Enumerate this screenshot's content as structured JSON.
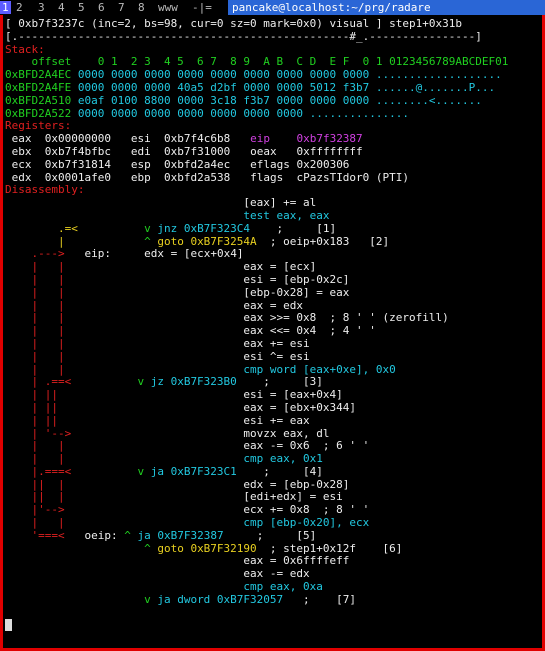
{
  "tabs": [
    {
      "label": "1",
      "active": true
    },
    {
      "label": "2",
      "active": false
    },
    {
      "label": "3",
      "active": false
    },
    {
      "label": "4",
      "active": false
    },
    {
      "label": "5",
      "active": false
    },
    {
      "label": "6",
      "active": false
    },
    {
      "label": "7",
      "active": false
    },
    {
      "label": "8",
      "active": false
    },
    {
      "label": "www",
      "active": false
    },
    {
      "label": "-|=",
      "active": false
    }
  ],
  "host_title": "pancake@localhost:~/prg/radare",
  "status_line": "[ 0xb7f3237c (inc=2, bs=98, cur=0 sz=0 mark=0x0) visual ] step1+0x31b",
  "ruler": "[.--------------------------------------------------#_.----------------]",
  "stack": {
    "label": "Stack:",
    "header": "    offset    0 1  2 3  4 5  6 7  8 9  A B  C D  E F  0 1 0123456789ABCDEF01",
    "rows": [
      {
        "addr": "0xBFD2A4EC",
        "hex": "0000 0000 0000 0000 0000 0000 0000 0000 0000",
        "ascii": "..................."
      },
      {
        "addr": "0xBFD2A4FE",
        "hex": "0000 0000 0000 40a5 d2bf 0000 0000 5012 f3b7",
        "ascii": "......@.......P..."
      },
      {
        "addr": "0xBFD2A510",
        "hex": "e0af 0100 8800 0000 3c18 f3b7 0000 0000 0000",
        "ascii": "........<......."
      },
      {
        "addr": "0xBFD2A522",
        "hex": "0000 0000 0000 0000 0000 0000 0000",
        "ascii": "..............."
      }
    ]
  },
  "registers": {
    "label": "Registers:",
    "rows": [
      [
        {
          "n": "eax",
          "v": "0x00000000"
        },
        {
          "n": "esi",
          "v": "0xb7f4c6b8"
        },
        {
          "n": "eip",
          "v": "0xb7f32387"
        }
      ],
      [
        {
          "n": "ebx",
          "v": "0xb7f4bfbc"
        },
        {
          "n": "edi",
          "v": "0xb7f31000"
        },
        {
          "n": "oeax",
          "v": "0xffffffff"
        }
      ],
      [
        {
          "n": "ecx",
          "v": "0xb7f31814"
        },
        {
          "n": "esp",
          "v": "0xbfd2a4ec"
        },
        {
          "n": "eflags",
          "v": "0x200306"
        }
      ],
      [
        {
          "n": "edx",
          "v": "0x0001afe0"
        },
        {
          "n": "ebp",
          "v": "0xbfd2a538"
        },
        {
          "n": "flags",
          "v": "cPazsTIdor0 (PTI)"
        }
      ]
    ]
  },
  "disasm": {
    "label": "Disassembly:",
    "lines": [
      [
        [
          "                                    ",
          "w"
        ],
        [
          "[eax] += al",
          "w"
        ]
      ],
      [
        [
          "                                    ",
          "w"
        ],
        [
          "test eax, eax",
          "c"
        ]
      ],
      [
        [
          "        .=<          ",
          "y"
        ],
        [
          "v ",
          "g"
        ],
        [
          "jnz 0xB7F323C4",
          "c"
        ],
        [
          "    ;     [1]",
          "w"
        ]
      ],
      [
        [
          "        |            ",
          "y"
        ],
        [
          "^ ",
          "g"
        ],
        [
          "goto 0xB7F3254A",
          "y"
        ],
        [
          "  ; oeip+0x183   [2]",
          "w"
        ]
      ],
      [
        [
          "    .--->   ",
          "r"
        ],
        [
          "eip:",
          "w"
        ],
        [
          "     ",
          "w"
        ],
        [
          "edx = [ecx+0x4]",
          "w"
        ]
      ],
      [
        [
          "    |   |                           ",
          "r"
        ],
        [
          "eax = [ecx]",
          "w"
        ]
      ],
      [
        [
          "    |   |                           ",
          "r"
        ],
        [
          "esi = [ebp-0x2c]",
          "w"
        ]
      ],
      [
        [
          "    |   |                           ",
          "r"
        ],
        [
          "[ebp-0x28] = eax",
          "w"
        ]
      ],
      [
        [
          "    |   |                           ",
          "r"
        ],
        [
          "eax = edx",
          "w"
        ]
      ],
      [
        [
          "    |   |                           ",
          "r"
        ],
        [
          "eax >>= 0x8  ; 8 ' ' (zerofill)",
          "w"
        ]
      ],
      [
        [
          "    |   |                           ",
          "r"
        ],
        [
          "eax <<= 0x4  ; 4 ' '",
          "w"
        ]
      ],
      [
        [
          "    |   |                           ",
          "r"
        ],
        [
          "eax += esi",
          "w"
        ]
      ],
      [
        [
          "    |   |                           ",
          "r"
        ],
        [
          "esi ^= esi",
          "w"
        ]
      ],
      [
        [
          "    |   |                           ",
          "r"
        ],
        [
          "cmp word [eax+0xe], 0x0",
          "c"
        ]
      ],
      [
        [
          "    | .==<          ",
          "r"
        ],
        [
          "v ",
          "g"
        ],
        [
          "jz 0xB7F323B0",
          "c"
        ],
        [
          "    ;     [3]",
          "w"
        ]
      ],
      [
        [
          "    | ||                            ",
          "r"
        ],
        [
          "esi = [eax+0x4]",
          "w"
        ]
      ],
      [
        [
          "    | ||                            ",
          "r"
        ],
        [
          "eax = [ebx+0x344]",
          "w"
        ]
      ],
      [
        [
          "    | ||                            ",
          "r"
        ],
        [
          "esi += eax",
          "w"
        ]
      ],
      [
        [
          "    | '-->                          ",
          "r"
        ],
        [
          "movzx eax, dl",
          "w"
        ]
      ],
      [
        [
          "    |   |                           ",
          "r"
        ],
        [
          "eax -= 0x6  ; 6 ' '",
          "w"
        ]
      ],
      [
        [
          "    |   |                           ",
          "r"
        ],
        [
          "cmp eax, 0x1",
          "c"
        ]
      ],
      [
        [
          "    |.===<          ",
          "r"
        ],
        [
          "v ",
          "g"
        ],
        [
          "ja 0xB7F323C1",
          "c"
        ],
        [
          "    ;     [4]",
          "w"
        ]
      ],
      [
        [
          "    ||  |                           ",
          "r"
        ],
        [
          "edx = [ebp-0x28]",
          "w"
        ]
      ],
      [
        [
          "    ||  |                           ",
          "r"
        ],
        [
          "[edi+edx] = esi",
          "w"
        ]
      ],
      [
        [
          "    |'-->                           ",
          "r"
        ],
        [
          "ecx += 0x8  ; 8 ' '",
          "w"
        ]
      ],
      [
        [
          "    |   |                           ",
          "r"
        ],
        [
          "cmp [ebp-0x20], ecx",
          "c"
        ]
      ],
      [
        [
          "    '===<   ",
          "r"
        ],
        [
          "oeip:",
          "w"
        ],
        [
          " ",
          "w"
        ],
        [
          "^ ",
          "g"
        ],
        [
          "ja 0xB7F32387",
          "c"
        ],
        [
          "     ;     [5]",
          "w"
        ]
      ],
      [
        [
          "                     ",
          "w"
        ],
        [
          "^ ",
          "g"
        ],
        [
          "goto 0xB7F32190",
          "y"
        ],
        [
          "  ; step1+0x12f    [6]",
          "w"
        ]
      ],
      [
        [
          "                                    ",
          "w"
        ],
        [
          "eax = 0x6ffffeff",
          "w"
        ]
      ],
      [
        [
          "                                    ",
          "w"
        ],
        [
          "eax -= edx",
          "w"
        ]
      ],
      [
        [
          "                                    ",
          "w"
        ],
        [
          "cmp eax, 0xa",
          "c"
        ]
      ],
      [
        [
          "                     ",
          "w"
        ],
        [
          "v ",
          "g"
        ],
        [
          "ja dword 0xB7F32057",
          "c"
        ],
        [
          "   ;    [7]",
          "w"
        ]
      ]
    ]
  },
  "colors": {
    "accent": "#e00000",
    "tabbar": "#2a66d6",
    "ascii_dots": "#22c8e0"
  }
}
